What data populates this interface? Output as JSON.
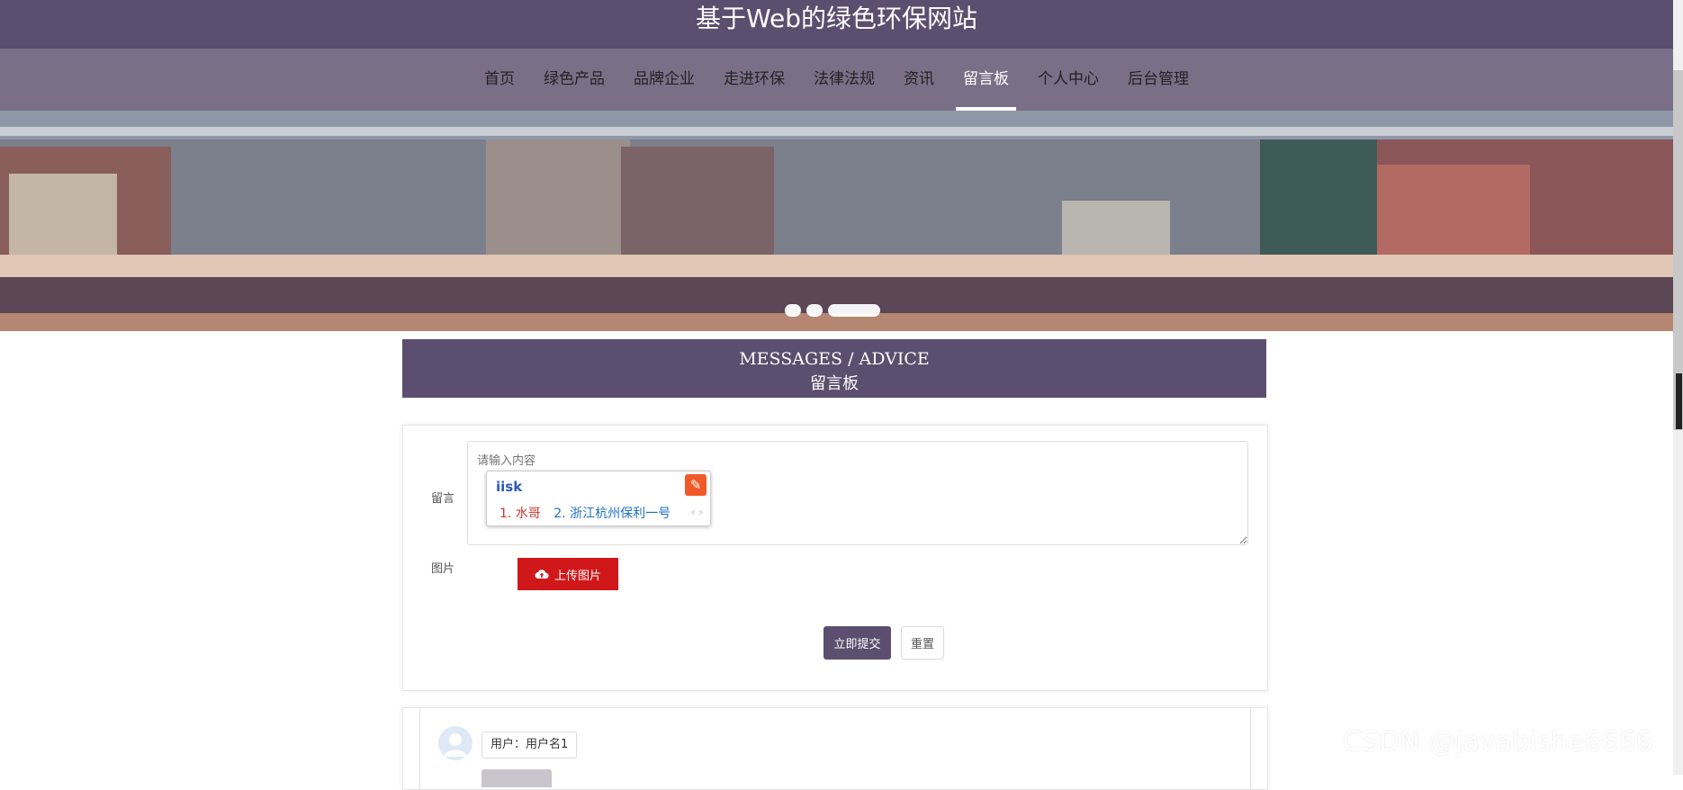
{
  "site": {
    "title": "基于Web的绿色环保网站"
  },
  "nav": {
    "items": [
      {
        "label": "首页"
      },
      {
        "label": "绿色产品"
      },
      {
        "label": "品牌企业"
      },
      {
        "label": "走进环保"
      },
      {
        "label": "法律法规"
      },
      {
        "label": "资讯"
      },
      {
        "label": "留言板",
        "active": true
      },
      {
        "label": "个人中心"
      },
      {
        "label": "后台管理"
      }
    ]
  },
  "banner": {
    "slides": 3,
    "active_slide": 3
  },
  "section": {
    "title_en": "MESSAGES / ADVICE",
    "title_cn": "留言板"
  },
  "form": {
    "message_label": "留言",
    "message_placeholder": "请输入内容",
    "image_label": "图片",
    "upload_label": "上传图片",
    "submit_label": "立即提交",
    "reset_label": "重置"
  },
  "ime": {
    "typed": "iisk",
    "candidates": [
      "1. 水哥",
      "2. 浙江杭州保利一号"
    ],
    "pager": "‹ ›"
  },
  "messages": [
    {
      "user": "用户：用户名1"
    }
  ],
  "watermark": "CSDN @javabishe6666",
  "colors": {
    "primary": "#5c4e6e",
    "nav_bg": "#7b6f88",
    "upload": "#d0181a"
  }
}
